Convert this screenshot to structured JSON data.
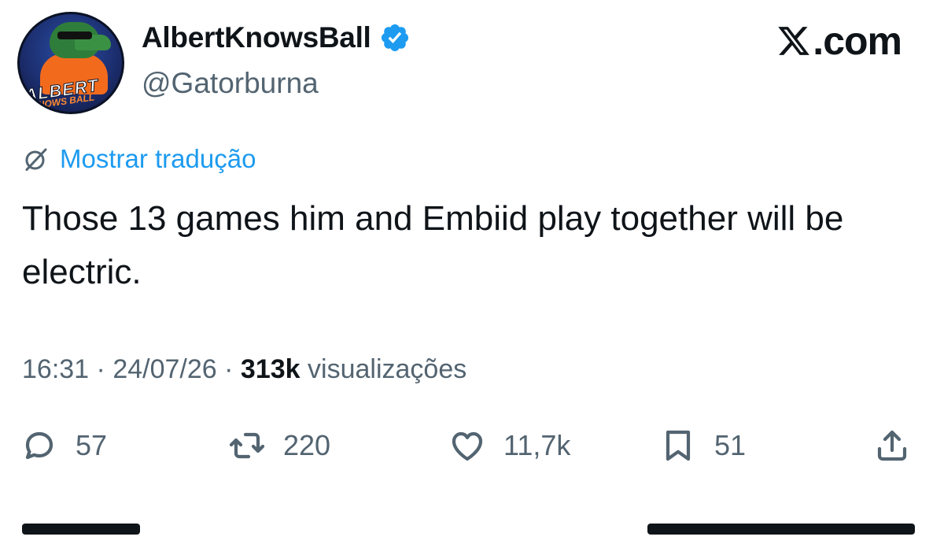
{
  "profile": {
    "display_name": "AlbertKnowsBall",
    "handle": "@Gatorburna",
    "avatar_text_line1": "ALBERT",
    "avatar_text_line2": "KNOWS BALL"
  },
  "brand": {
    "text": ".com"
  },
  "translate": {
    "label": "Mostrar tradução"
  },
  "tweet": {
    "text": "Those 13 games him and Embiid play together will be electric."
  },
  "meta": {
    "time": "16:31",
    "separator": "·",
    "date": "24/07/26",
    "views_count": "313k",
    "views_label": "visualizações"
  },
  "actions": {
    "replies": "57",
    "reposts": "220",
    "likes": "11,7k",
    "bookmarks": "51"
  },
  "colors": {
    "accent": "#1d9bf0",
    "text_primary": "#0f1419",
    "text_secondary": "#536471"
  },
  "icons": {
    "verified": "verified-badge-icon",
    "translate": "globe-slash-icon",
    "reply": "speech-bubble-icon",
    "repost": "repost-arrows-icon",
    "like": "heart-icon",
    "bookmark": "bookmark-icon",
    "share": "share-upload-icon",
    "brand": "x-logo-icon"
  }
}
